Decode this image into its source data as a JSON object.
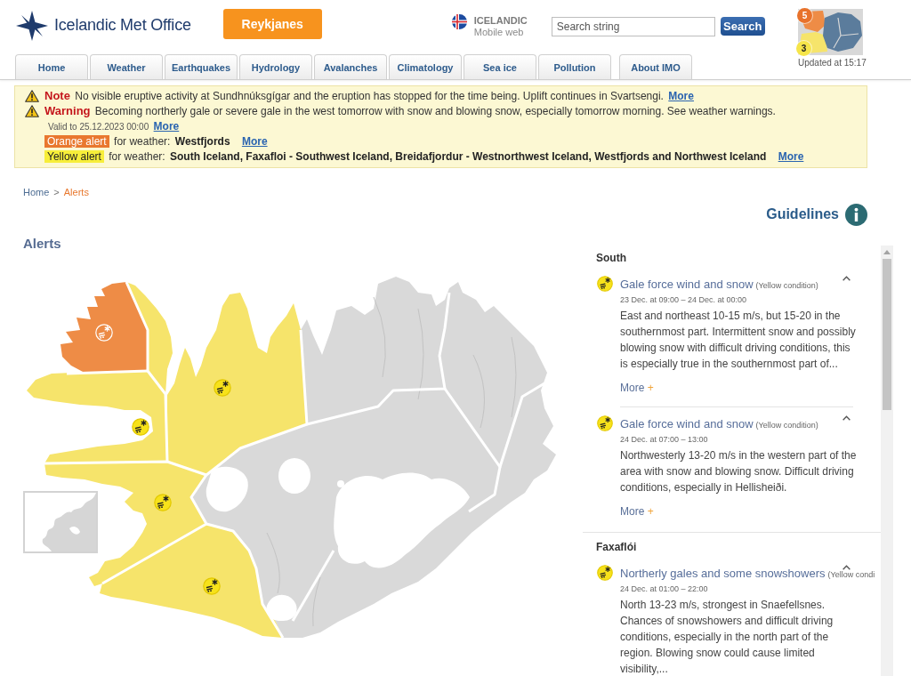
{
  "header": {
    "logo": "Icelandic Met Office",
    "region_button": "Reykjanes",
    "language": {
      "name": "ICELANDIC",
      "subtitle": "Mobile web"
    },
    "search": {
      "placeholder": "Search string",
      "button": "Search"
    },
    "alert_thumbnail": {
      "badges": [
        {
          "text": "5",
          "color": "#e8722b"
        },
        {
          "text": "3",
          "color": "#f6e54a"
        }
      ],
      "updated": "Updated at 15:17"
    }
  },
  "nav_tabs": [
    {
      "label": "Home",
      "selected": false
    },
    {
      "label": "Weather",
      "selected": false
    },
    {
      "label": "Earthquakes",
      "selected": false
    },
    {
      "label": "Hydrology",
      "selected": false
    },
    {
      "label": "Avalanches",
      "selected": false
    },
    {
      "label": "Climatology",
      "selected": false
    },
    {
      "label": "Sea ice",
      "selected": false
    },
    {
      "label": "Pollution",
      "selected": false
    },
    {
      "label": "About IMO",
      "selected": false
    }
  ],
  "notices": [
    {
      "label": "Note",
      "text": "No visible eruptive activity at Sundhnúksgígar and the eruption has stopped for the time being. Uplift continues in Svartsengi.",
      "more": "More"
    },
    {
      "label": "Warning",
      "text": "Becoming northerly gale or severe gale in the west tomorrow with snow and blowing snow, especially tomorrow morning. See weather warnings.",
      "valid": "Valid to 25.12.2023 00:00",
      "more": "More"
    }
  ],
  "weather_alerts": [
    {
      "label": "Orange alert",
      "color": "#e9782f",
      "prefix": "for weather:",
      "areas": "Westfjords",
      "more": "More"
    },
    {
      "label": "Yellow alert",
      "color": "#f7ee3a",
      "prefix": "for weather:",
      "areas": "South Iceland, Faxafloi - Southwest Iceland, Breidafjordur - Westnorthwest Iceland, Westfjords and Northwest Iceland",
      "more": "More"
    }
  ],
  "breadcrumb": {
    "separator": ">",
    "items": [
      {
        "label": "Home",
        "current": false
      },
      {
        "label": "Alerts",
        "current": true
      }
    ]
  },
  "guidelines": "Guidelines",
  "alerts_heading": "Alerts",
  "alert_list": {
    "sections": [
      {
        "name": "South",
        "alerts": [
          {
            "title": "Gale force wind and snow",
            "condition": "(Yellow condition)",
            "time": "23 Dec. at 09:00 – 24 Dec. at 00:00",
            "description": "East and northeast 10-15 m/s, but 15-20 in the southernmost part. Intermittent snow and possibly blowing snow with difficult driving conditions, this is especially true in the southernmost part of...",
            "more": "More",
            "expand_sign": "+",
            "expanded": true
          },
          {
            "title": "Gale force wind and snow",
            "condition": "(Yellow condition)",
            "time": "24 Dec. at 07:00 – 13:00",
            "description": "Northwesterly 13-20 m/s in the western part of the area with snow and blowing snow. Difficult driving conditions, especially in Hellisheiði.",
            "more": "More",
            "expand_sign": "+",
            "expanded": true
          }
        ]
      },
      {
        "name": "Faxaflói",
        "alerts": [
          {
            "title": "Northerly gales and some snowshowers",
            "condition": "(Yellow condi",
            "time": "24 Dec. at 01:00 – 22:00",
            "description": "North 13-23 m/s, strongest in Snaefellsnes. Chances of snowshowers and difficult driving conditions, especially in the north part of the region. Blowing snow could cause limited visibility,...",
            "expanded": true
          }
        ]
      }
    ]
  }
}
